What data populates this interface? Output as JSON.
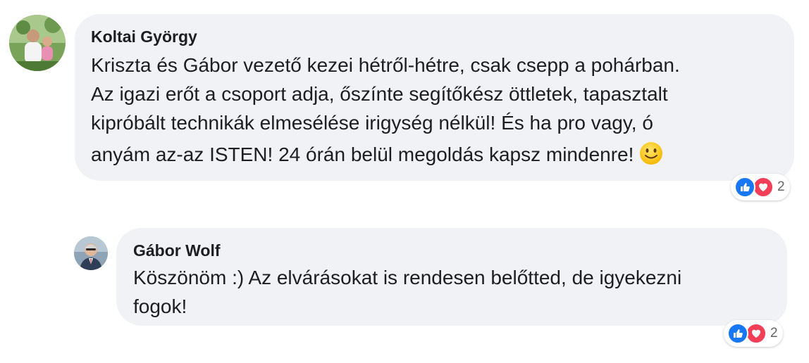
{
  "comments": [
    {
      "author": "Koltai György",
      "lines": [
        "Kriszta és Gábor vezető kezei hétről-hétre, csak csepp a pohárban.",
        "Az igazi erőt a csoport adja, őszínte segítőkész öttletek, tapasztalt",
        "kipróbált technikák elmesélése irigység nélkül! És ha pro vagy,  ó",
        "anyám az-az ISTEN! 24 órán belül megoldás kapsz mindenre!"
      ],
      "emoji": "slightly-smiling-face",
      "reactions": {
        "types": [
          "like",
          "love"
        ],
        "count": "2"
      }
    },
    {
      "author": "Gábor Wolf",
      "lines": [
        "Köszönöm :) Az elvárásokat is rendesen belőtted, de igyekezni",
        "fogok!"
      ],
      "reactions": {
        "types": [
          "like",
          "love"
        ],
        "count": "2"
      }
    }
  ],
  "colors": {
    "bubble": "#f0f2f5",
    "like": "#1877f2",
    "love": "#f33e58",
    "secondary_text": "#65676b"
  }
}
